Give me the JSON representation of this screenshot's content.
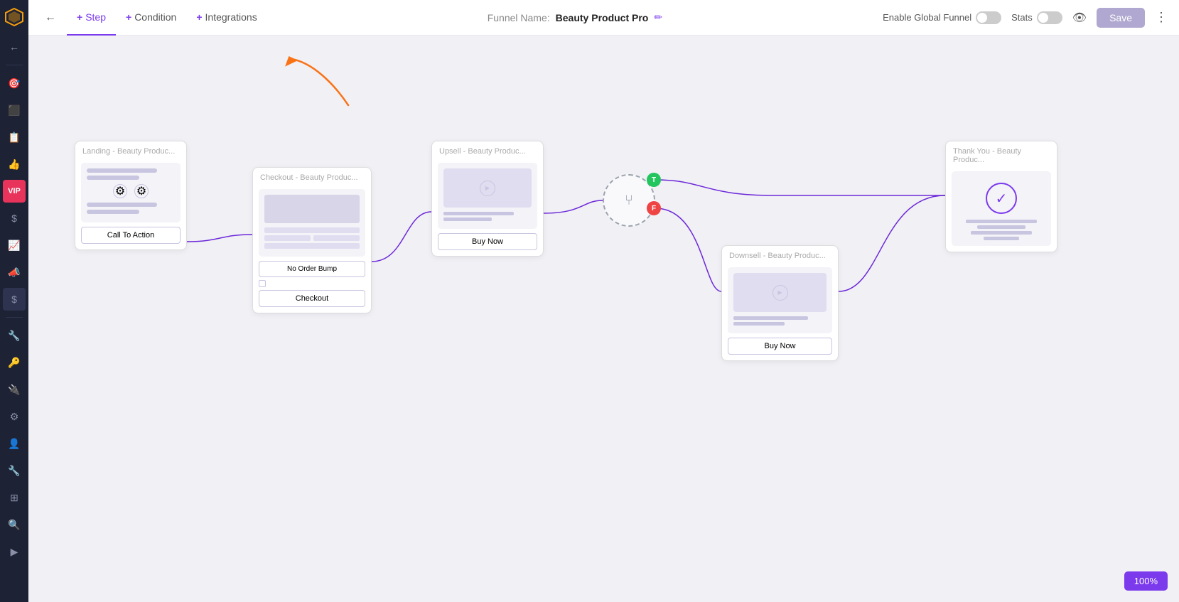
{
  "sidebar": {
    "icons": [
      "☰",
      "←",
      "🎯",
      "📊",
      "📋",
      "👍",
      "V",
      "$",
      "📈",
      "📣",
      "$",
      "🔧",
      "🔑",
      "🔌",
      "🔧",
      "👤",
      "🔧",
      "⊞",
      "🔍",
      "▶"
    ]
  },
  "topbar": {
    "back_label": "←",
    "nav": [
      {
        "label": "Step",
        "prefix": "+",
        "active": true
      },
      {
        "label": "Condition",
        "prefix": "+",
        "active": false
      },
      {
        "label": "Integrations",
        "prefix": "+",
        "active": false
      }
    ],
    "funnel_label": "Funnel Name:",
    "funnel_name": "Beauty Product Pro",
    "enable_global_funnel_label": "Enable Global Funnel",
    "stats_label": "Stats",
    "save_label": "Save"
  },
  "nodes": {
    "landing": {
      "title": "Landing",
      "subtitle": "- Beauty Produc...",
      "cta": "Call To Action"
    },
    "checkout": {
      "title": "Checkout",
      "subtitle": "- Beauty Produc...",
      "no_order_bump": "No Order Bump",
      "cta": "Checkout"
    },
    "upsell": {
      "title": "Upsell",
      "subtitle": "- Beauty Produc...",
      "cta": "Buy Now"
    },
    "condition": {
      "true_label": "T",
      "false_label": "F"
    },
    "downsell": {
      "title": "Downsell",
      "subtitle": "- Beauty Produc...",
      "cta": "Buy Now"
    },
    "thankyou": {
      "title": "Thank You",
      "subtitle": "- Beauty Produc..."
    }
  },
  "zoom": {
    "level": "100%"
  }
}
